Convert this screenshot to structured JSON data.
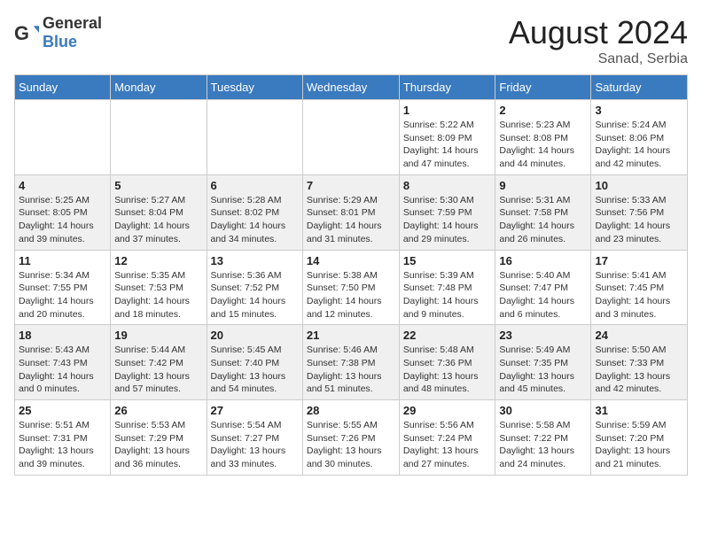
{
  "header": {
    "logo_general": "General",
    "logo_blue": "Blue",
    "title": "August 2024",
    "subtitle": "Sanad, Serbia"
  },
  "weekdays": [
    "Sunday",
    "Monday",
    "Tuesday",
    "Wednesday",
    "Thursday",
    "Friday",
    "Saturday"
  ],
  "weeks": [
    [
      {
        "day": "",
        "info": ""
      },
      {
        "day": "",
        "info": ""
      },
      {
        "day": "",
        "info": ""
      },
      {
        "day": "",
        "info": ""
      },
      {
        "day": "1",
        "info": "Sunrise: 5:22 AM\nSunset: 8:09 PM\nDaylight: 14 hours\nand 47 minutes."
      },
      {
        "day": "2",
        "info": "Sunrise: 5:23 AM\nSunset: 8:08 PM\nDaylight: 14 hours\nand 44 minutes."
      },
      {
        "day": "3",
        "info": "Sunrise: 5:24 AM\nSunset: 8:06 PM\nDaylight: 14 hours\nand 42 minutes."
      }
    ],
    [
      {
        "day": "4",
        "info": "Sunrise: 5:25 AM\nSunset: 8:05 PM\nDaylight: 14 hours\nand 39 minutes."
      },
      {
        "day": "5",
        "info": "Sunrise: 5:27 AM\nSunset: 8:04 PM\nDaylight: 14 hours\nand 37 minutes."
      },
      {
        "day": "6",
        "info": "Sunrise: 5:28 AM\nSunset: 8:02 PM\nDaylight: 14 hours\nand 34 minutes."
      },
      {
        "day": "7",
        "info": "Sunrise: 5:29 AM\nSunset: 8:01 PM\nDaylight: 14 hours\nand 31 minutes."
      },
      {
        "day": "8",
        "info": "Sunrise: 5:30 AM\nSunset: 7:59 PM\nDaylight: 14 hours\nand 29 minutes."
      },
      {
        "day": "9",
        "info": "Sunrise: 5:31 AM\nSunset: 7:58 PM\nDaylight: 14 hours\nand 26 minutes."
      },
      {
        "day": "10",
        "info": "Sunrise: 5:33 AM\nSunset: 7:56 PM\nDaylight: 14 hours\nand 23 minutes."
      }
    ],
    [
      {
        "day": "11",
        "info": "Sunrise: 5:34 AM\nSunset: 7:55 PM\nDaylight: 14 hours\nand 20 minutes."
      },
      {
        "day": "12",
        "info": "Sunrise: 5:35 AM\nSunset: 7:53 PM\nDaylight: 14 hours\nand 18 minutes."
      },
      {
        "day": "13",
        "info": "Sunrise: 5:36 AM\nSunset: 7:52 PM\nDaylight: 14 hours\nand 15 minutes."
      },
      {
        "day": "14",
        "info": "Sunrise: 5:38 AM\nSunset: 7:50 PM\nDaylight: 14 hours\nand 12 minutes."
      },
      {
        "day": "15",
        "info": "Sunrise: 5:39 AM\nSunset: 7:48 PM\nDaylight: 14 hours\nand 9 minutes."
      },
      {
        "day": "16",
        "info": "Sunrise: 5:40 AM\nSunset: 7:47 PM\nDaylight: 14 hours\nand 6 minutes."
      },
      {
        "day": "17",
        "info": "Sunrise: 5:41 AM\nSunset: 7:45 PM\nDaylight: 14 hours\nand 3 minutes."
      }
    ],
    [
      {
        "day": "18",
        "info": "Sunrise: 5:43 AM\nSunset: 7:43 PM\nDaylight: 14 hours\nand 0 minutes."
      },
      {
        "day": "19",
        "info": "Sunrise: 5:44 AM\nSunset: 7:42 PM\nDaylight: 13 hours\nand 57 minutes."
      },
      {
        "day": "20",
        "info": "Sunrise: 5:45 AM\nSunset: 7:40 PM\nDaylight: 13 hours\nand 54 minutes."
      },
      {
        "day": "21",
        "info": "Sunrise: 5:46 AM\nSunset: 7:38 PM\nDaylight: 13 hours\nand 51 minutes."
      },
      {
        "day": "22",
        "info": "Sunrise: 5:48 AM\nSunset: 7:36 PM\nDaylight: 13 hours\nand 48 minutes."
      },
      {
        "day": "23",
        "info": "Sunrise: 5:49 AM\nSunset: 7:35 PM\nDaylight: 13 hours\nand 45 minutes."
      },
      {
        "day": "24",
        "info": "Sunrise: 5:50 AM\nSunset: 7:33 PM\nDaylight: 13 hours\nand 42 minutes."
      }
    ],
    [
      {
        "day": "25",
        "info": "Sunrise: 5:51 AM\nSunset: 7:31 PM\nDaylight: 13 hours\nand 39 minutes."
      },
      {
        "day": "26",
        "info": "Sunrise: 5:53 AM\nSunset: 7:29 PM\nDaylight: 13 hours\nand 36 minutes."
      },
      {
        "day": "27",
        "info": "Sunrise: 5:54 AM\nSunset: 7:27 PM\nDaylight: 13 hours\nand 33 minutes."
      },
      {
        "day": "28",
        "info": "Sunrise: 5:55 AM\nSunset: 7:26 PM\nDaylight: 13 hours\nand 30 minutes."
      },
      {
        "day": "29",
        "info": "Sunrise: 5:56 AM\nSunset: 7:24 PM\nDaylight: 13 hours\nand 27 minutes."
      },
      {
        "day": "30",
        "info": "Sunrise: 5:58 AM\nSunset: 7:22 PM\nDaylight: 13 hours\nand 24 minutes."
      },
      {
        "day": "31",
        "info": "Sunrise: 5:59 AM\nSunset: 7:20 PM\nDaylight: 13 hours\nand 21 minutes."
      }
    ]
  ]
}
